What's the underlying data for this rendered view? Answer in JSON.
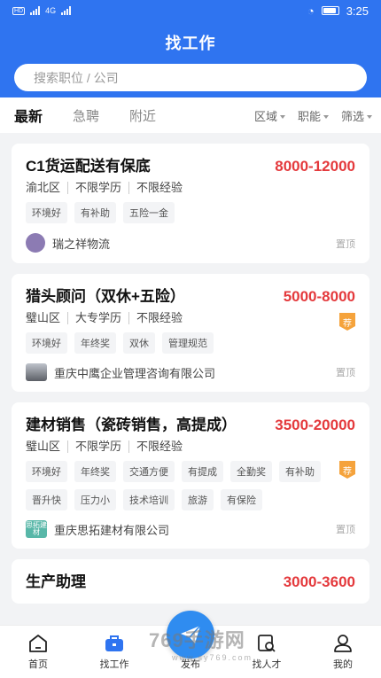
{
  "status": {
    "carrier": "HD",
    "net": "4G",
    "time": "3:25"
  },
  "header": {
    "title": "找工作"
  },
  "search": {
    "placeholder": "搜索职位 / 公司"
  },
  "filter_tabs": [
    "最新",
    "急聘",
    "附近"
  ],
  "filter_menus": [
    "区域",
    "职能",
    "筛选"
  ],
  "jobs": [
    {
      "title": "C1货运配送有保底",
      "salary": "8000-12000",
      "meta": [
        "渝北区",
        "不限学历",
        "不限经验"
      ],
      "tags": [
        "环境好",
        "有补助",
        "五险一金"
      ],
      "company": "瑞之祥物流",
      "pin": "置顶"
    },
    {
      "title": "猎头顾问（双休+五险）",
      "salary": "5000-8000",
      "meta": [
        "璧山区",
        "大专学历",
        "不限经验"
      ],
      "tags": [
        "环境好",
        "年终奖",
        "双休",
        "管理规范"
      ],
      "company": "重庆中鹰企业管理咨询有限公司",
      "pin": "置顶",
      "badge": "荐"
    },
    {
      "title": "建材销售（瓷砖销售，高提成）",
      "salary": "3500-20000",
      "meta": [
        "璧山区",
        "不限学历",
        "不限经验"
      ],
      "tags": [
        "环境好",
        "年终奖",
        "交通方便",
        "有提成",
        "全勤奖",
        "有补助",
        "晋升快",
        "压力小",
        "技术培训",
        "旅游",
        "有保险"
      ],
      "company": "重庆思拓建材有限公司",
      "pin": "置顶",
      "badge": "荐",
      "logo_text": "思拓建材"
    },
    {
      "title": "生产助理",
      "salary": "3000-3600"
    }
  ],
  "tabbar": [
    "首页",
    "找工作",
    "发布",
    "找人才",
    "我的"
  ],
  "watermark": {
    "main": "769手游网",
    "sub": "www.sy769.com"
  },
  "colors": {
    "primary": "#2f74f0",
    "salary": "#e4393c",
    "badge": "#f5a33c"
  }
}
